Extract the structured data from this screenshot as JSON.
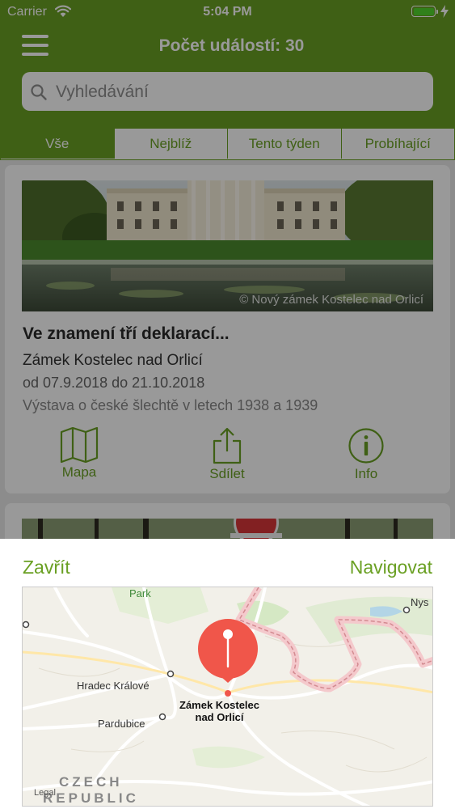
{
  "status_bar": {
    "carrier": "Carrier",
    "time": "5:04 PM"
  },
  "header": {
    "title": "Počet událostí: 30",
    "search_placeholder": "Vyhledávání"
  },
  "tabs": [
    {
      "label": "Vše",
      "active": true
    },
    {
      "label": "Nejblíž",
      "active": false
    },
    {
      "label": "Tento týden",
      "active": false
    },
    {
      "label": "Probíhající",
      "active": false
    }
  ],
  "event": {
    "image_caption": "© Nový zámek Kostelec nad Orlicí",
    "title": "Ve znamení tří deklarací...",
    "venue": "Zámek Kostelec nad Orlicí",
    "dates": "od 07.9.2018 do 21.10.2018",
    "description": "Výstava o české šlechtě v letech 1938 a 1939",
    "actions": {
      "map": "Mapa",
      "share": "Sdílet",
      "info": "Info"
    }
  },
  "sheet": {
    "close_label": "Zavřít",
    "navigate_label": "Navigovat",
    "map": {
      "labels": {
        "park": "Park",
        "nysa": "Nys",
        "hradec": "Hradec Králové",
        "pardubice": "Pardubice",
        "destination_line1": "Zámek Kostelec",
        "destination_line2": "nad Orlicí",
        "country_line1": "CZECH",
        "country_line2": "REPUBLIC",
        "legal": "Legal"
      },
      "pin_color": "#f0564a",
      "border_color": "#e0a8ac"
    }
  },
  "colors": {
    "accent": "#6aa023"
  }
}
